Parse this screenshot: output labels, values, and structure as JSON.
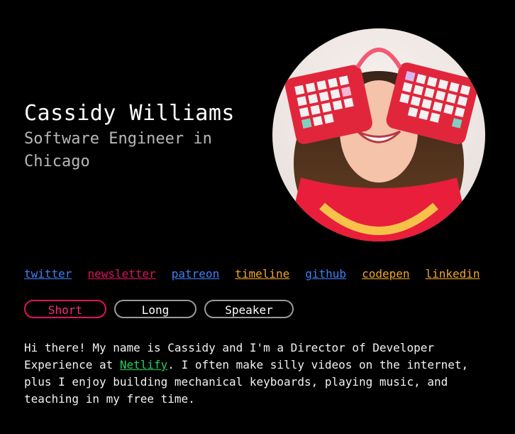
{
  "profile": {
    "name": "Cassidy Williams",
    "subtitle_line1": "Software Engineer in",
    "subtitle_line2": "Chicago"
  },
  "links": [
    {
      "label": "twitter",
      "color": "#3b82f6"
    },
    {
      "label": "newsletter",
      "color": "#e0115f"
    },
    {
      "label": "patreon",
      "color": "#3b82f6"
    },
    {
      "label": "timeline",
      "color": "#f5a623"
    },
    {
      "label": "github",
      "color": "#3b82f6"
    },
    {
      "label": "codepen",
      "color": "#f5a623"
    },
    {
      "label": "linkedin",
      "color": "#f5a623"
    }
  ],
  "tabs": [
    {
      "label": "Short",
      "active": true
    },
    {
      "label": "Long",
      "active": false
    },
    {
      "label": "Speaker",
      "active": false
    }
  ],
  "bio": {
    "before_link": "Hi there! My name is Cassidy and I'm a Director of Developer Experience at ",
    "link_text": "Netlify",
    "after_link": ". I often make silly videos on the internet, plus I enjoy building mechanical keyboards, playing music, and teaching in my free time."
  },
  "colors": {
    "accent_pink": "#e0115f",
    "link_blue": "#3b82f6",
    "link_orange": "#f5a623",
    "link_green": "#1fd35b"
  }
}
